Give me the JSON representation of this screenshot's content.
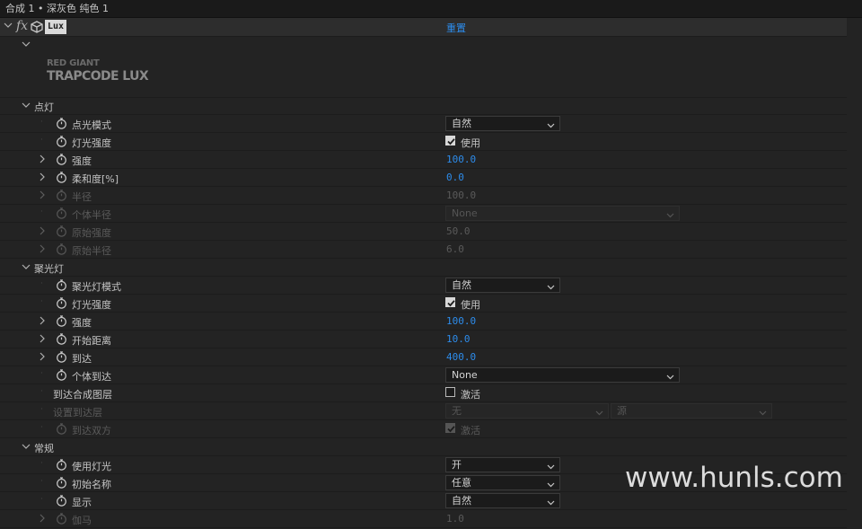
{
  "title": "合成 1 • 深灰色 纯色 1",
  "effect": {
    "fx_label": "fx",
    "name": "Lux",
    "reset": "重置",
    "logo_line1": "RED GIANT",
    "logo_line2": "TRAPCODE LUX"
  },
  "rows": [
    {
      "kind": "group",
      "label": "点灯"
    },
    {
      "kind": "prop",
      "label": "点光模式",
      "sw": true,
      "ctrl": "dropdown",
      "value": "自然",
      "width": "normal"
    },
    {
      "kind": "prop",
      "label": "灯光强度",
      "sw": true,
      "ctrl": "checkbox",
      "checked": true,
      "value": "使用"
    },
    {
      "kind": "prop",
      "label": "强度",
      "sw": true,
      "tw": true,
      "ctrl": "number",
      "value": "100.0"
    },
    {
      "kind": "prop",
      "label": "柔和度[%]",
      "sw": true,
      "tw": true,
      "ctrl": "number",
      "value": "0.0"
    },
    {
      "kind": "prop",
      "label": "半径",
      "sw": true,
      "tw": true,
      "disabled": true,
      "ctrl": "number",
      "value": "100.0"
    },
    {
      "kind": "prop",
      "label": "个体半径",
      "sw": true,
      "disabled": true,
      "ctrl": "dropdown",
      "value": "None",
      "width": "wide"
    },
    {
      "kind": "prop",
      "label": "原始强度",
      "sw": true,
      "tw": true,
      "disabled": true,
      "ctrl": "number",
      "value": "50.0"
    },
    {
      "kind": "prop",
      "label": "原始半径",
      "sw": true,
      "tw": true,
      "disabled": true,
      "ctrl": "number",
      "value": "6.0"
    },
    {
      "kind": "group",
      "label": "聚光灯"
    },
    {
      "kind": "prop",
      "label": "聚光灯模式",
      "sw": true,
      "ctrl": "dropdown",
      "value": "自然",
      "width": "normal"
    },
    {
      "kind": "prop",
      "label": "灯光强度",
      "sw": true,
      "ctrl": "checkbox",
      "checked": true,
      "value": "使用"
    },
    {
      "kind": "prop",
      "label": "强度",
      "sw": true,
      "tw": true,
      "ctrl": "number",
      "value": "100.0"
    },
    {
      "kind": "prop",
      "label": "开始距离",
      "sw": true,
      "tw": true,
      "ctrl": "number",
      "value": "10.0"
    },
    {
      "kind": "prop",
      "label": "到达",
      "sw": true,
      "tw": true,
      "ctrl": "number",
      "value": "400.0"
    },
    {
      "kind": "prop",
      "label": "个体到达",
      "sw": true,
      "ctrl": "dropdown",
      "value": "None",
      "width": "wide"
    },
    {
      "kind": "prop",
      "label": "到达合成图层",
      "ctrl": "checkbox",
      "checked": false,
      "value": "激活"
    },
    {
      "kind": "prop",
      "label": "设置到达层",
      "disabled": true,
      "ctrl": "dropdown2",
      "value": "无",
      "value2": "源"
    },
    {
      "kind": "prop",
      "label": "到达双方",
      "sw": true,
      "disabled": true,
      "ctrl": "checkbox",
      "checked": true,
      "value": "激活"
    },
    {
      "kind": "group",
      "label": "常规"
    },
    {
      "kind": "prop",
      "label": "使用灯光",
      "sw": true,
      "ctrl": "dropdown",
      "value": "开",
      "width": "normal"
    },
    {
      "kind": "prop",
      "label": "初始名称",
      "sw": true,
      "ctrl": "dropdown",
      "value": "任意",
      "width": "normal"
    },
    {
      "kind": "prop",
      "label": "显示",
      "sw": true,
      "ctrl": "dropdown",
      "value": "自然",
      "width": "normal"
    },
    {
      "kind": "prop",
      "label": "伽马",
      "sw": true,
      "tw": true,
      "disabled": true,
      "ctrl": "number",
      "value": "1.0"
    }
  ],
  "watermark": "www.hunls.com",
  "colors": {
    "accent": "#2d8ceb",
    "panel": "#232323",
    "header": "#2d2d2d"
  }
}
